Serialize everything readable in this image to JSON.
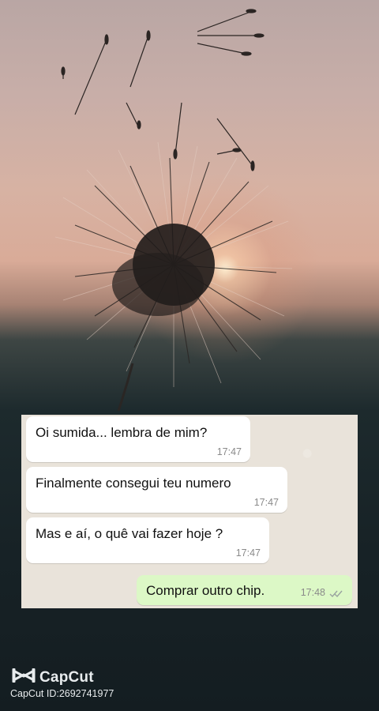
{
  "chat": {
    "messages": [
      {
        "direction": "incoming",
        "text": "Oi sumida... lembra de mim?",
        "time": "17:47"
      },
      {
        "direction": "incoming",
        "text": "Finalmente consegui teu numero",
        "time": "17:47"
      },
      {
        "direction": "incoming",
        "text": "Mas e aí, o quê vai fazer hoje ?",
        "time": "17:47"
      },
      {
        "direction": "outgoing",
        "text": "Comprar outro chip.",
        "time": "17:48",
        "status_icon": "double-check-icon"
      }
    ]
  },
  "watermark": {
    "brand": "CapCut",
    "id_text": "CapCut ID:2692741977",
    "icon": "capcut-logo-icon"
  },
  "colors": {
    "incoming_bubble": "#ffffff",
    "outgoing_bubble": "#dcf8c6",
    "chat_background": "#e9e3da"
  }
}
